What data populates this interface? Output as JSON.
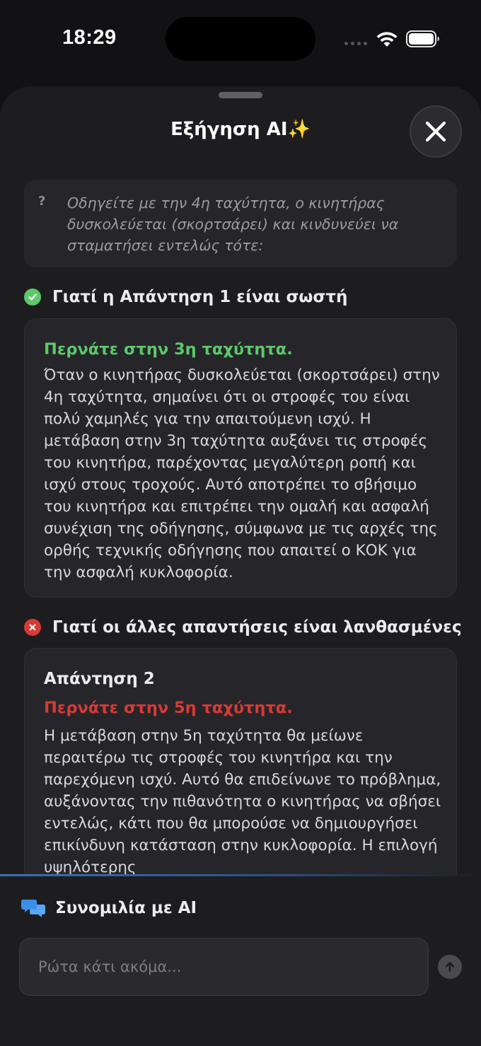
{
  "status_bar": {
    "time": "18:29"
  },
  "sheet": {
    "title": "Εξήγηση AI✨",
    "close_icon": "close-icon"
  },
  "question": {
    "mark": "?",
    "text": "Οδηγείτε με την 4η ταχύτητα, ο κινητήρας δυσκολεύεται (σκορτσάρει) και κινδυνεύει να σταματήσει εντελώς τότε:"
  },
  "correct_section": {
    "heading": "Γιατί η Απάντηση 1 είναι σωστή",
    "icon": "check-circle-icon",
    "answer_title": "Περνάτε στην 3η ταχύτητα.",
    "explanation": "Όταν ο κινητήρας δυσκολεύεται (σκορτσάρει) στην 4η ταχύτητα, σημαίνει ότι οι στροφές του είναι πολύ χαμηλές για την απαιτούμενη ισχύ. Η μετάβαση στην 3η ταχύτητα αυξάνει τις στροφές του κινητήρα, παρέχοντας μεγαλύτερη ροπή και ισχύ στους τροχούς. Αυτό αποτρέπει το σβήσιμο του κινητήρα και επιτρέπει την ομαλή και ασφαλή συνέχιση της οδήγησης, σύμφωνα με τις αρχές της ορθής τεχνικής οδήγησης που απαιτεί ο ΚΟΚ για την ασφαλή κυκλοφορία."
  },
  "wrong_section": {
    "heading": "Γιατί οι άλλες απαντήσεις είναι λανθασμένες",
    "icon": "x-circle-icon",
    "answers": [
      {
        "label": "Απάντηση 2",
        "title": "Περνάτε στην 5η ταχύτητα.",
        "explanation": "Η μετάβαση στην 5η ταχύτητα θα μείωνε περαιτέρω τις στροφές του κινητήρα και την παρεχόμενη ισχύ. Αυτό θα επιδείνωνε το πρόβλημα, αυξάνοντας την πιθανότητα ο κινητήρας να σβήσει εντελώς, κάτι που θα μπορούσε να δημιουργήσει επικίνδυνη κατάσταση στην κυκλοφορία. Η επιλογή υψηλότερης"
      }
    ]
  },
  "chat": {
    "header": "Συνομιλία με AI",
    "icon": "chat-bubbles-icon",
    "input_value": "",
    "input_placeholder": "Ρώτα κάτι ακόμα...",
    "send_icon": "arrow-up-icon"
  },
  "colors": {
    "correct": "#5cc86a",
    "wrong": "#d83a35",
    "accent_blue": "#3b8fe8"
  }
}
